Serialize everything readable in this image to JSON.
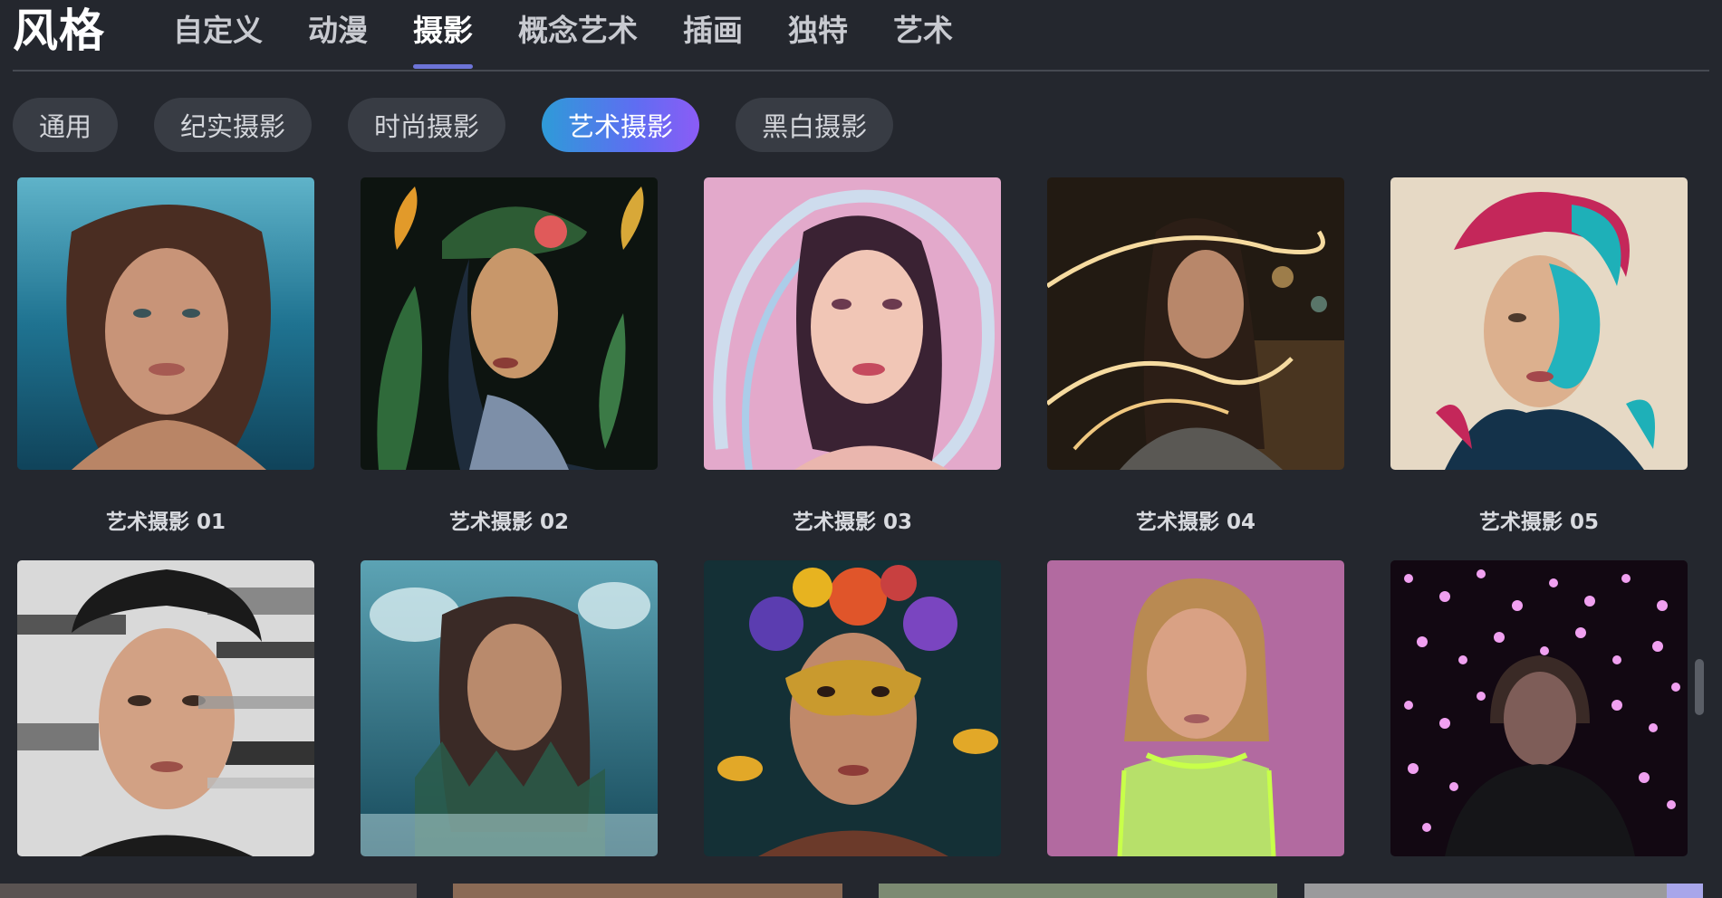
{
  "header": {
    "title": "风格",
    "tabs": [
      {
        "label": "自定义",
        "active": false
      },
      {
        "label": "动漫",
        "active": false
      },
      {
        "label": "摄影",
        "active": true
      },
      {
        "label": "概念艺术",
        "active": false
      },
      {
        "label": "插画",
        "active": false
      },
      {
        "label": "独特",
        "active": false
      },
      {
        "label": "艺术",
        "active": false
      }
    ]
  },
  "subcategories": [
    {
      "label": "通用",
      "active": false
    },
    {
      "label": "纪实摄影",
      "active": false
    },
    {
      "label": "时尚摄影",
      "active": false
    },
    {
      "label": "艺术摄影",
      "active": true
    },
    {
      "label": "黑白摄影",
      "active": false
    }
  ],
  "styles_row1": [
    {
      "caption": "艺术摄影 01",
      "icon": "underwater-portrait-thumbnail"
    },
    {
      "caption": "艺术摄影 02",
      "icon": "botanical-portrait-thumbnail"
    },
    {
      "caption": "艺术摄影 03",
      "icon": "glass-swirl-portrait-thumbnail"
    },
    {
      "caption": "艺术摄影 04",
      "icon": "light-trail-portrait-thumbnail"
    },
    {
      "caption": "艺术摄影 05",
      "icon": "paint-splash-portrait-thumbnail"
    }
  ],
  "styles_row2": [
    {
      "icon": "glitch-portrait-thumbnail"
    },
    {
      "icon": "double-exposure-portrait-thumbnail"
    },
    {
      "icon": "flower-mask-portrait-thumbnail"
    },
    {
      "icon": "neon-portrait-thumbnail"
    },
    {
      "icon": "bokeh-portrait-thumbnail"
    }
  ],
  "colors": {
    "background": "#24272e",
    "accent": "#6d74d8",
    "chip_gradient_start": "#2e9bd8",
    "chip_gradient_end": "#8b5cf6"
  }
}
